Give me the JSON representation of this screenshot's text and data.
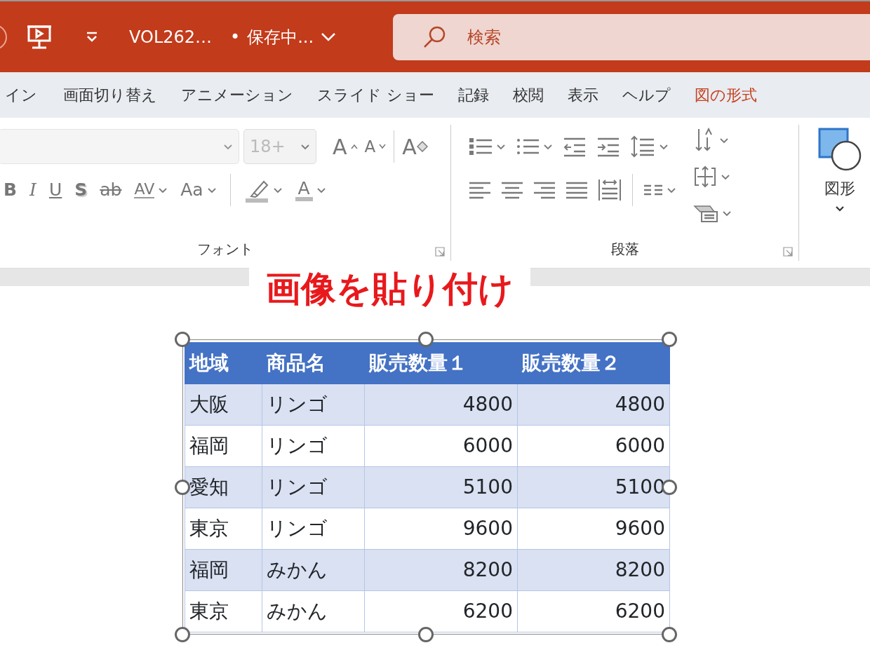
{
  "title_bar": {
    "file_name": "VOL262…",
    "separator": "•",
    "save_status": "保存中...",
    "search": {
      "placeholder": "検索"
    }
  },
  "tabs": [
    {
      "label": "イン",
      "contextual": false
    },
    {
      "label": "画面切り替え",
      "contextual": false
    },
    {
      "label": "アニメーション",
      "contextual": false
    },
    {
      "label": "スライド ショー",
      "contextual": false
    },
    {
      "label": "記録",
      "contextual": false
    },
    {
      "label": "校閲",
      "contextual": false
    },
    {
      "label": "表示",
      "contextual": false
    },
    {
      "label": "ヘルプ",
      "contextual": false
    },
    {
      "label": "図の形式",
      "contextual": true
    }
  ],
  "font_group": {
    "label": "フォント",
    "font_name": {
      "disabled": true
    },
    "font_size": {
      "value": "18+",
      "disabled": true
    },
    "top_row": [
      {
        "kind": "grow",
        "glyph": "A",
        "dropdown": false
      },
      {
        "kind": "shrink",
        "glyph": "A",
        "dropdown": false
      },
      {
        "kind": "separator"
      },
      {
        "kind": "clear",
        "glyph": "A",
        "dropdown": false
      }
    ],
    "bottom_row": [
      {
        "kind": "bold",
        "glyph": "B",
        "dropdown": false
      },
      {
        "kind": "italic",
        "glyph": "I",
        "dropdown": false
      },
      {
        "kind": "underline",
        "glyph": "U",
        "dropdown": false
      },
      {
        "kind": "shadow",
        "glyph": "S",
        "dropdown": false
      },
      {
        "kind": "strike",
        "glyph": "ab",
        "dropdown": false
      },
      {
        "kind": "spacing",
        "glyph": "AV",
        "dropdown": true
      },
      {
        "kind": "case",
        "glyph": "Aa",
        "dropdown": true
      },
      {
        "kind": "separator"
      },
      {
        "kind": "highlight",
        "dropdown": true
      },
      {
        "kind": "color",
        "glyph": "A",
        "dropdown": true
      }
    ]
  },
  "paragraph_group": {
    "label": "段落",
    "top_row": [
      {
        "kind": "bullets",
        "dropdown": true
      },
      {
        "kind": "numbering",
        "dropdown": true
      },
      {
        "kind": "indent-decrease",
        "dropdown": false
      },
      {
        "kind": "indent-increase",
        "dropdown": false
      },
      {
        "kind": "line-spacing",
        "dropdown": true
      }
    ],
    "bottom_row": [
      {
        "kind": "align-left",
        "dropdown": false
      },
      {
        "kind": "align-center",
        "dropdown": false
      },
      {
        "kind": "align-right",
        "dropdown": false
      },
      {
        "kind": "justify",
        "dropdown": false
      },
      {
        "kind": "distribute",
        "dropdown": false
      },
      {
        "kind": "separator"
      },
      {
        "kind": "columns",
        "dropdown": true
      }
    ],
    "side": [
      {
        "kind": "text-direction",
        "dropdown": true
      },
      {
        "kind": "align-text",
        "dropdown": true
      },
      {
        "kind": "smartart",
        "dropdown": true
      }
    ]
  },
  "shapes_group": {
    "label": "図形"
  },
  "caption": "画像を貼り付け",
  "table": {
    "columns": [
      "地域",
      "商品名",
      "販売数量１",
      "販売数量２"
    ],
    "rows": [
      [
        "大阪",
        "リンゴ",
        "4800",
        "4800"
      ],
      [
        "福岡",
        "リンゴ",
        "6000",
        "6000"
      ],
      [
        "愛知",
        "リンゴ",
        "5100",
        "5100"
      ],
      [
        "東京",
        "リンゴ",
        "9600",
        "9600"
      ],
      [
        "福岡",
        "みかん",
        "8200",
        "8200"
      ],
      [
        "東京",
        "みかん",
        "6200",
        "6200"
      ]
    ]
  }
}
